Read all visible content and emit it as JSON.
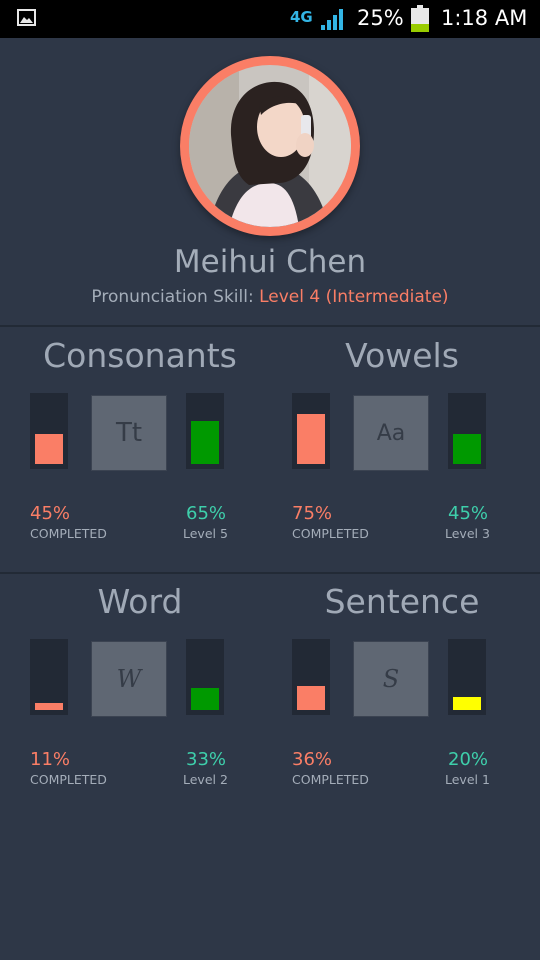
{
  "status": {
    "network": "4G",
    "battery": "25%",
    "time": "1:18 AM"
  },
  "profile": {
    "name": "Meihui Chen",
    "skill_label": "Pronunciation Skill: ",
    "skill_level": "Level 4 (Intermediate)"
  },
  "colors": {
    "coral": "#fa7e66",
    "green": "#009900",
    "yellow": "#ffff00",
    "teal": "#3ecfab"
  },
  "sections": [
    {
      "title": "Consonants",
      "glyph": "Tt",
      "completed": "45%",
      "completed_label": "COMPLETED",
      "level_pct": "65%",
      "level_label": "Level 5",
      "completed_fill": 0.45,
      "level_fill": 0.65,
      "level_color": "#009900"
    },
    {
      "title": "Vowels",
      "glyph": "Aa",
      "completed": "75%",
      "completed_label": "COMPLETED",
      "level_pct": "45%",
      "level_label": "Level 3",
      "completed_fill": 0.75,
      "level_fill": 0.45,
      "level_color": "#009900"
    },
    {
      "title": "Word",
      "glyph": "W",
      "completed": "11%",
      "completed_label": "COMPLETED",
      "level_pct": "33%",
      "level_label": "Level 2",
      "completed_fill": 0.11,
      "level_fill": 0.33,
      "level_color": "#009900"
    },
    {
      "title": "Sentence",
      "glyph": "S",
      "completed": "36%",
      "completed_label": "COMPLETED",
      "level_pct": "20%",
      "level_label": "Level 1",
      "completed_fill": 0.36,
      "level_fill": 0.2,
      "level_color": "#ffff00"
    }
  ]
}
